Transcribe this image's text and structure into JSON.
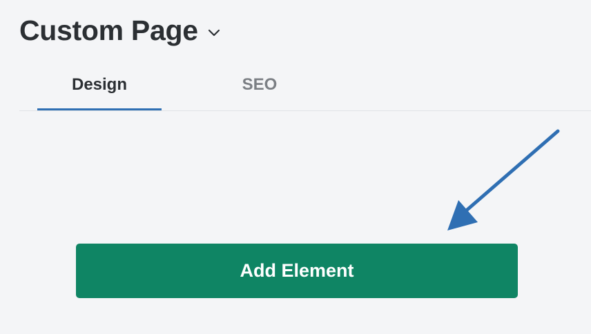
{
  "header": {
    "title": "Custom Page",
    "dropdown_icon": "chevron-down-icon"
  },
  "tabs": [
    {
      "label": "Design",
      "active": true
    },
    {
      "label": "SEO",
      "active": false
    }
  ],
  "main": {
    "add_button_label": "Add Element"
  },
  "annotation": {
    "icon": "arrow-pointer-icon",
    "color": "#2f6fb3"
  },
  "colors": {
    "accent": "#2f6fb3",
    "button": "#0f8564",
    "background": "#f4f5f7"
  }
}
